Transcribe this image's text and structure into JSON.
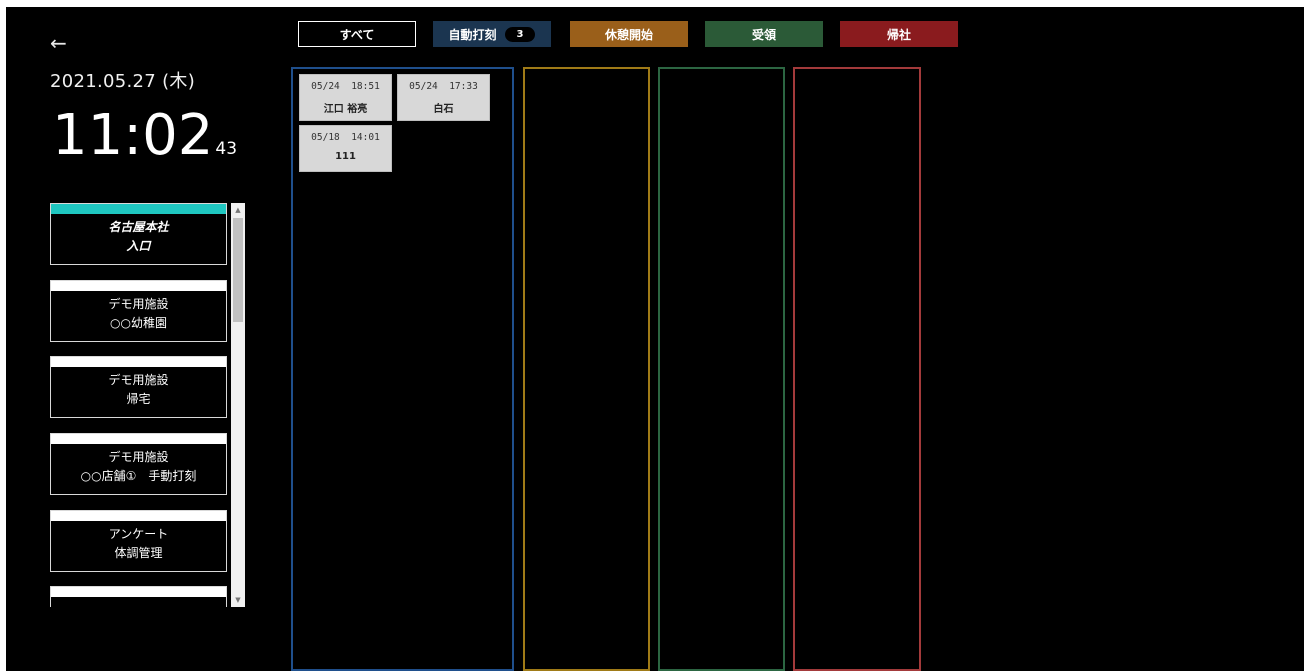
{
  "header": {
    "back_icon": "←",
    "date": "2021.05.27 (木)",
    "time_main": "11:02",
    "time_seconds": "43"
  },
  "facilities": [
    {
      "line1": "名古屋本社",
      "line2": "入口",
      "selected": true
    },
    {
      "line1": "デモ用施設",
      "line2": "○○幼稚園"
    },
    {
      "line1": "デモ用施設",
      "line2": "帰宅"
    },
    {
      "line1": "デモ用施設",
      "line2": "○○店舗①　手動打刻"
    },
    {
      "line1": "アンケート",
      "line2": "体調管理"
    },
    {
      "line1": "",
      "line2": ""
    }
  ],
  "scrollbar": {
    "up": "▲",
    "down": "▼"
  },
  "filters": {
    "all": "すべて",
    "auto": "自動打刻",
    "auto_count": "3",
    "break_start": "休憩開始",
    "receive": "受領",
    "return": "帰社"
  },
  "colors": {
    "selected_accent": "#1fc7c1",
    "auto": "#1b3550",
    "break_start": "#9a5f1a",
    "receive": "#2b5a37",
    "return": "#8a1b1e"
  },
  "cards": [
    {
      "datetime": "05/24  18:51",
      "name": "江口 裕亮"
    },
    {
      "datetime": "05/24  17:33",
      "name": "白石"
    },
    {
      "datetime": "05/18  14:01",
      "name": "111"
    }
  ]
}
